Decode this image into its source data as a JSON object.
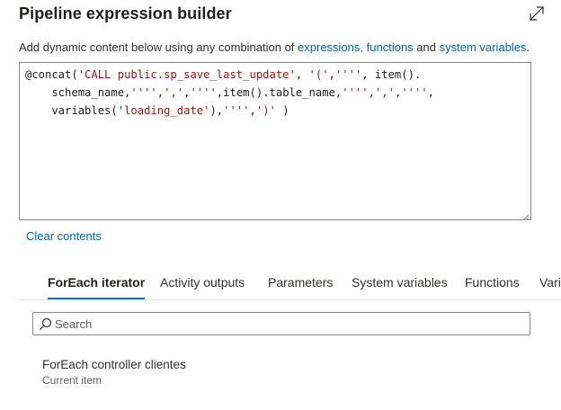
{
  "header": {
    "title": "Pipeline expression builder",
    "expand_icon": "expand-diagonal-icon"
  },
  "description": {
    "prefix": "Add dynamic content below using any combination of ",
    "link_expressions": "expressions,",
    "link_functions": "functions",
    "middle": " and ",
    "link_system_variables": "system variables",
    "suffix": "."
  },
  "editor": {
    "line1_a": "@concat(",
    "line1_b": "'CALL public.sp_save_last_update'",
    "line1_c": ", ",
    "line1_d": "'('",
    "line1_e": ",",
    "line1_f": "''''",
    "line1_g": ", item().",
    "line2_a": "    schema_name,",
    "line2_b": "''''",
    "line2_c": ",",
    "line2_d": "','",
    "line2_e": ",",
    "line2_f": "''''",
    "line2_g": ",item().table_name,",
    "line2_h": "''''",
    "line2_i": ",",
    "line2_j": "','",
    "line2_k": ",",
    "line2_l": "''''",
    "line2_m": ",",
    "line3_a": "    variables(",
    "line3_b": "'loading_date'",
    "line3_c": "),",
    "line3_d": "''''",
    "line3_e": ",",
    "line3_f": "')'",
    "line3_g": " )"
  },
  "clear_contents": "Clear contents",
  "tabs": [
    {
      "label": "ForEach iterator",
      "active": true
    },
    {
      "label": "Activity outputs",
      "active": false
    },
    {
      "label": "Parameters",
      "active": false
    },
    {
      "label": "System variables",
      "active": false
    },
    {
      "label": "Functions",
      "active": false
    },
    {
      "label": "Vari",
      "active": false
    }
  ],
  "search": {
    "placeholder": "Search",
    "value": ""
  },
  "items": [
    {
      "title": "ForEach controller clientes",
      "subtitle": "Current item"
    }
  ],
  "colors": {
    "link": "#0067b8",
    "accent": "#0078d4",
    "string": "#a31515"
  }
}
